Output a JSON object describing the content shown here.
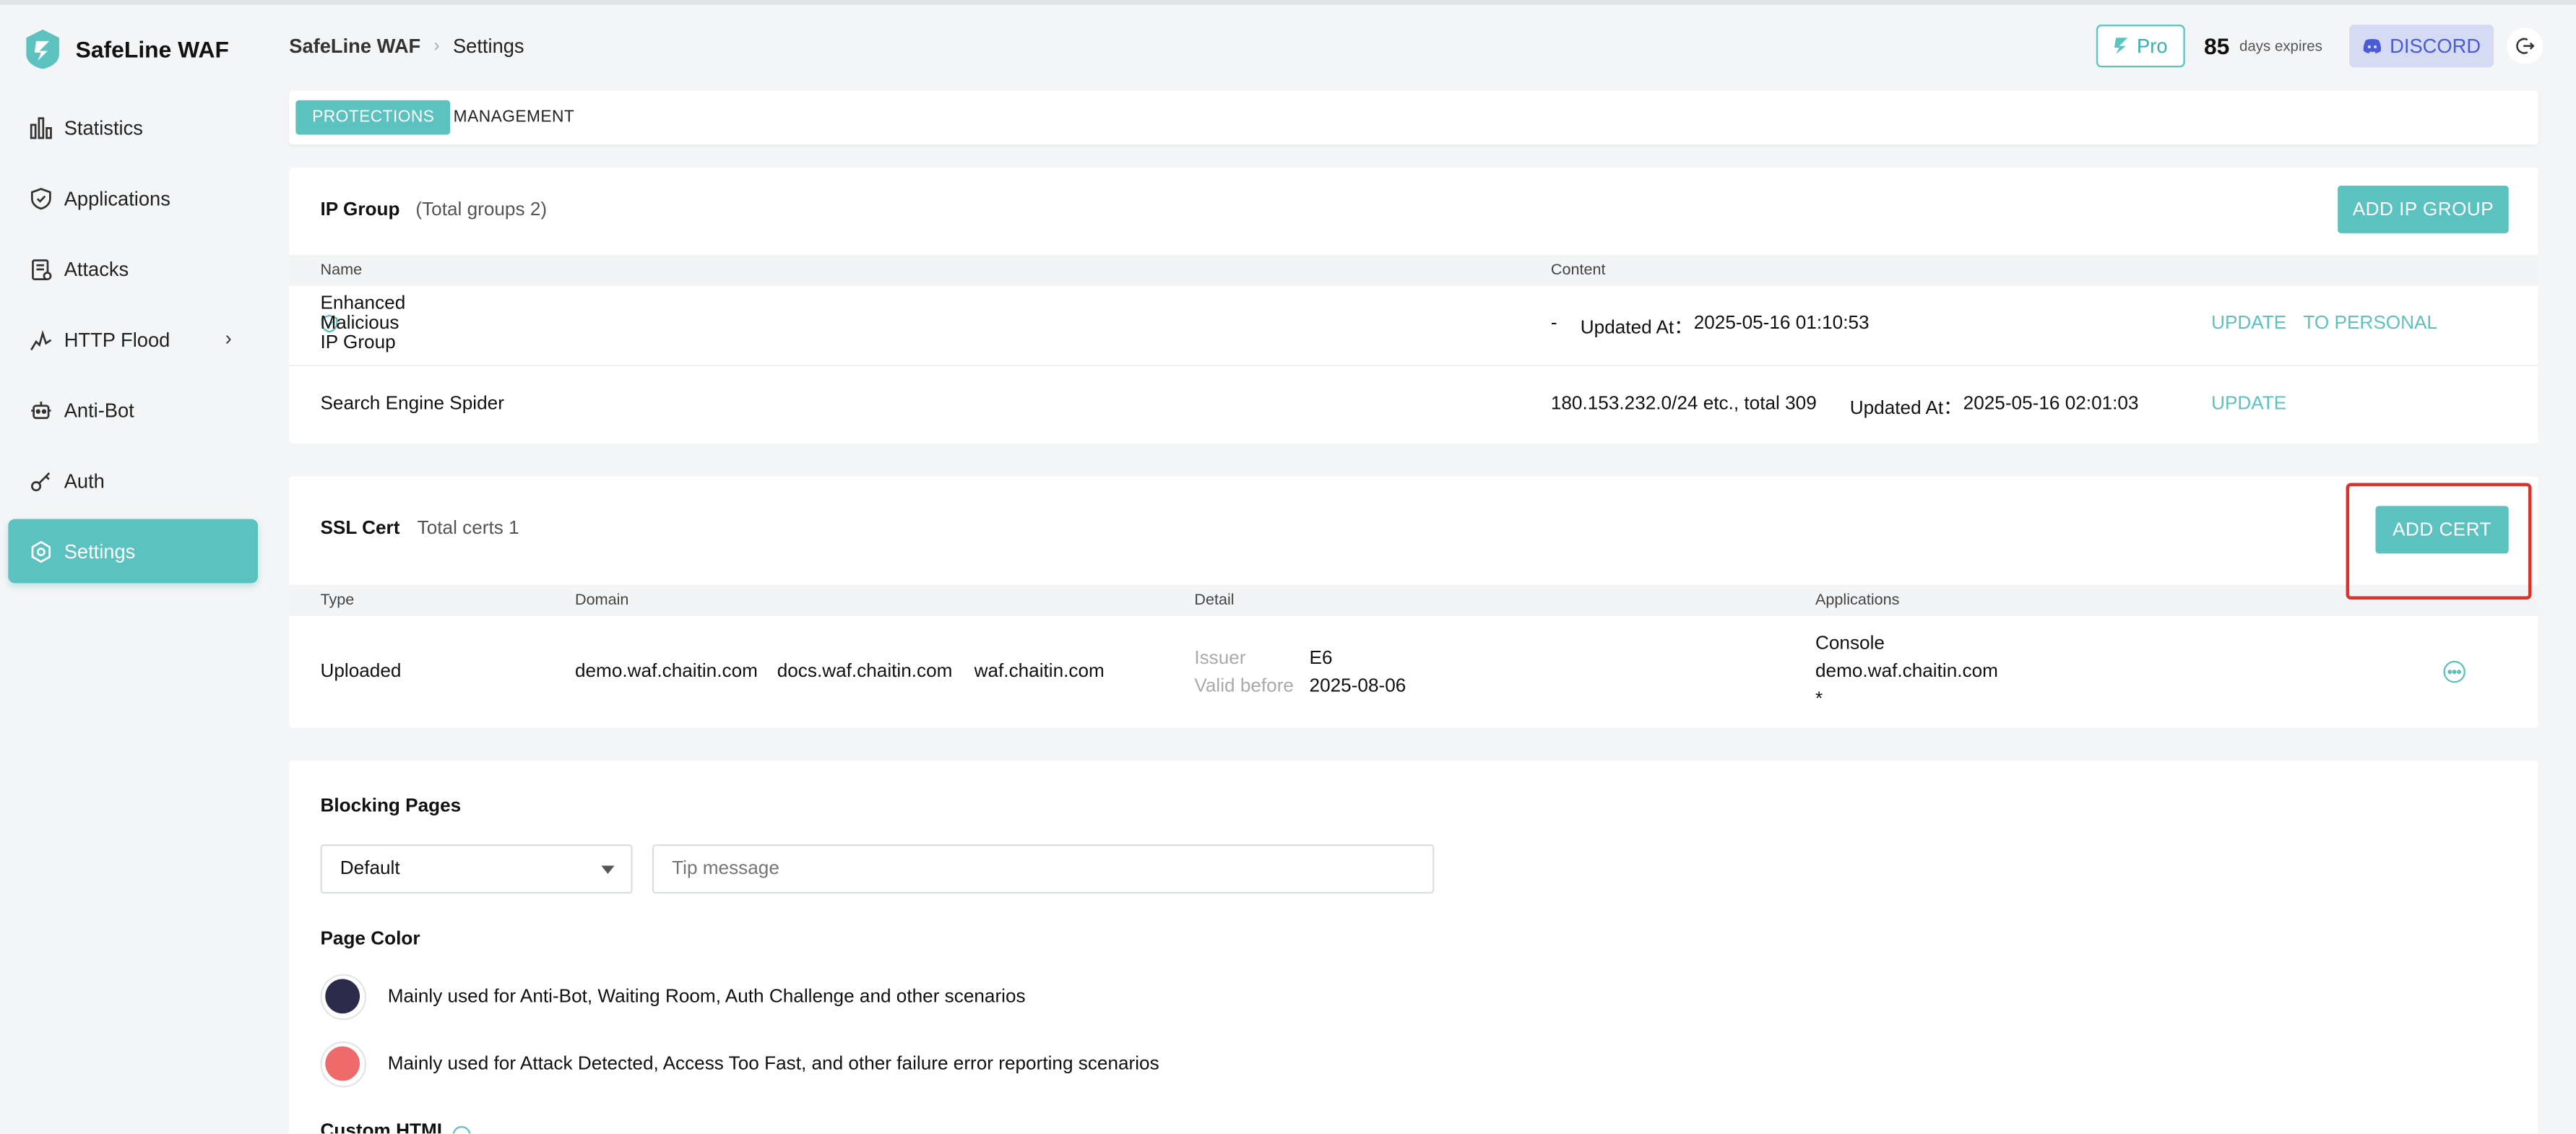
{
  "app": {
    "name": "SafeLine WAF"
  },
  "colors": {
    "accent": "#5bc2bf",
    "highlight_box": "#d9342b",
    "page_color_primary": "#2b2a4b",
    "page_color_error": "#ef6b6b",
    "discord_bg": "#d5dbf3",
    "discord_text": "#4a5bd6"
  },
  "sidebar": {
    "items": [
      {
        "label": "Statistics",
        "icon": "bar-chart-icon"
      },
      {
        "label": "Applications",
        "icon": "shield-icon"
      },
      {
        "label": "Attacks",
        "icon": "clipboard-icon"
      },
      {
        "label": "HTTP Flood",
        "icon": "pulse-icon",
        "has_submenu": true
      },
      {
        "label": "Anti-Bot",
        "icon": "robot-icon"
      },
      {
        "label": "Auth",
        "icon": "key-icon"
      },
      {
        "label": "Settings",
        "icon": "gear-icon",
        "active": true
      }
    ]
  },
  "header": {
    "breadcrumb": [
      "SafeLine WAF",
      "Settings"
    ],
    "pro_label": "Pro",
    "days_count": "85",
    "days_label": "days expires",
    "discord_label": "DISCORD"
  },
  "tabs": [
    {
      "label": "PROTECTIONS",
      "active": true
    },
    {
      "label": "MANAGEMENT",
      "active": false
    }
  ],
  "ip_group": {
    "title": "IP Group",
    "subtitle": "(Total groups 2)",
    "add_button": "ADD IP GROUP",
    "columns": [
      "Name",
      "Content"
    ],
    "rows": [
      {
        "name": "Enhanced Malicious IP Group",
        "verified": true,
        "content": "-",
        "updated_label": "Updated At：",
        "updated_at": "2025-05-16 01:10:53",
        "actions": [
          "UPDATE",
          "TO PERSONAL"
        ]
      },
      {
        "name": "Search Engine Spider",
        "verified": false,
        "content": "180.153.232.0/24 etc., total 309",
        "updated_label": "Updated At：",
        "updated_at": "2025-05-16 02:01:03",
        "actions": [
          "UPDATE"
        ]
      }
    ]
  },
  "ssl_cert": {
    "title": "SSL Cert",
    "subtitle": "Total certs 1",
    "add_button": "ADD CERT",
    "columns": [
      "Type",
      "Domain",
      "Detail",
      "Applications"
    ],
    "rows": [
      {
        "type": "Uploaded",
        "domains": [
          "demo.waf.chaitin.com",
          "docs.waf.chaitin.com",
          "waf.chaitin.com"
        ],
        "issuer_label": "Issuer",
        "issuer": "E6",
        "valid_label": "Valid before",
        "valid_before": "2025-08-06",
        "applications": [
          "Console",
          "demo.waf.chaitin.com",
          "*"
        ]
      }
    ]
  },
  "blocking_pages": {
    "title": "Blocking Pages",
    "select_value": "Default",
    "tip_placeholder": "Tip message",
    "page_color_title": "Page Color",
    "color_options": [
      {
        "label": "Mainly used for Anti-Bot, Waiting Room, Auth Challenge and other scenarios"
      },
      {
        "label": "Mainly used for Attack Detected, Access Too Fast, and other failure error reporting scenarios"
      }
    ],
    "custom_html_title": "Custom HTML"
  }
}
